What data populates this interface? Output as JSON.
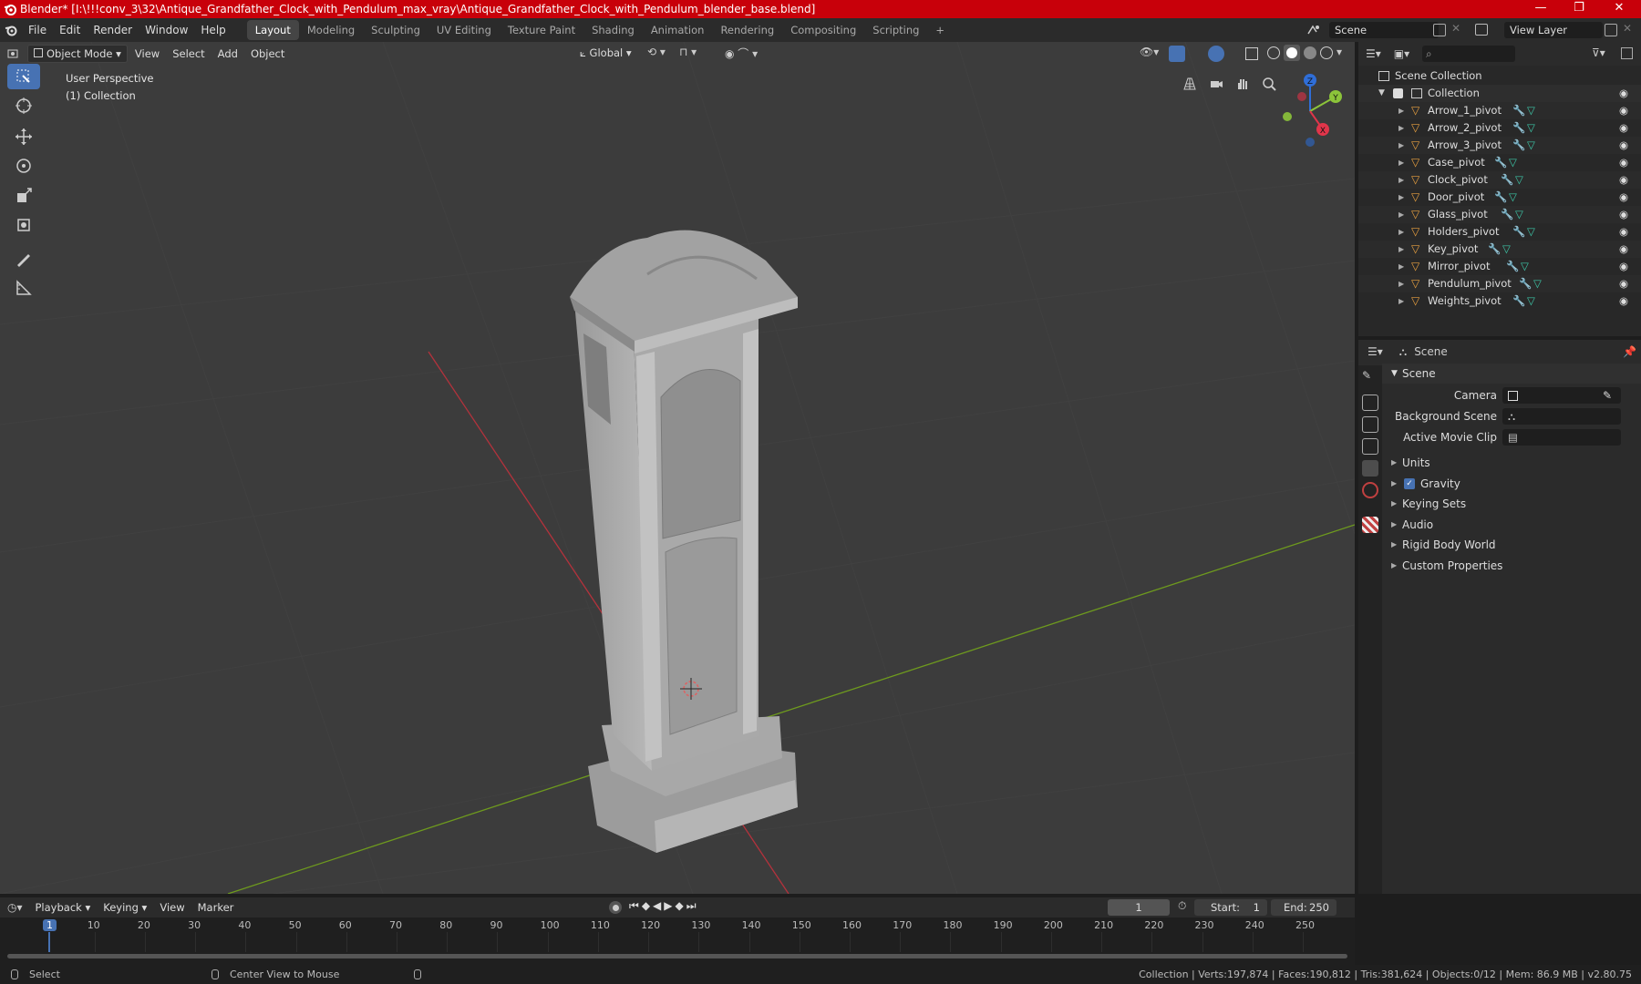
{
  "window": {
    "title": "Blender* [I:\\!!!conv_3\\32\\Antique_Grandfather_Clock_with_Pendulum_max_vray\\Antique_Grandfather_Clock_with_Pendulum_blender_base.blend]",
    "minimize": "—",
    "restore": "❐",
    "close": "✕"
  },
  "menus": [
    "File",
    "Edit",
    "Render",
    "Window",
    "Help"
  ],
  "workspaces": [
    "Layout",
    "Modeling",
    "Sculpting",
    "UV Editing",
    "Texture Paint",
    "Shading",
    "Animation",
    "Rendering",
    "Compositing",
    "Scripting"
  ],
  "workspace_add": "+",
  "scene_field": "Scene",
  "view_layer_field": "View Layer",
  "viewport": {
    "mode": "Object Mode",
    "menus": [
      "View",
      "Select",
      "Add",
      "Object"
    ],
    "orientation": "Global",
    "perspective_label": "User Perspective",
    "collection_label": "(1) Collection",
    "gizmo": {
      "x": "X",
      "y": "Y",
      "z": "Z"
    }
  },
  "outliner": {
    "search_placeholder": "",
    "root": "Scene Collection",
    "collection": "Collection",
    "items": [
      "Arrow_1_pivot",
      "Arrow_2_pivot",
      "Arrow_3_pivot",
      "Case_pivot",
      "Clock_pivot",
      "Door_pivot",
      "Glass_pivot",
      "Holders_pivot",
      "Key_pivot",
      "Mirror_pivot",
      "Pendulum_pivot",
      "Weights_pivot"
    ]
  },
  "properties": {
    "header": "Scene",
    "section": "Scene",
    "camera_label": "Camera",
    "background_scene_label": "Background Scene",
    "active_movie_clip_label": "Active Movie Clip",
    "panels": [
      "Units",
      "Gravity",
      "Keying Sets",
      "Audio",
      "Rigid Body World",
      "Custom Properties"
    ],
    "gravity_checked": true
  },
  "timeline": {
    "menus": [
      "Playback",
      "Keying",
      "View",
      "Marker"
    ],
    "current_frame": "1",
    "start_label": "Start:",
    "start": "1",
    "end_label": "End:",
    "end": "250",
    "ticks": [
      "1",
      "10",
      "20",
      "30",
      "40",
      "50",
      "60",
      "70",
      "80",
      "90",
      "100",
      "110",
      "120",
      "130",
      "140",
      "150",
      "160",
      "170",
      "180",
      "190",
      "200",
      "210",
      "220",
      "230",
      "240",
      "250"
    ]
  },
  "status": {
    "left": "Select",
    "middle": "Center View to Mouse",
    "right": "Collection | Verts:197,874 | Faces:190,812 | Tris:381,624 | Objects:0/12 | Mem: 86.9 MB | v2.80.75"
  },
  "colors": {
    "titlebar": "#c8000a",
    "accent": "#4772b3",
    "viewport_bg": "#3c3c3c",
    "axis_x": "#b4323c",
    "axis_y": "#6e9a1e",
    "object_icon": "#e8a040",
    "mesh_icon": "#3dc7a8"
  }
}
